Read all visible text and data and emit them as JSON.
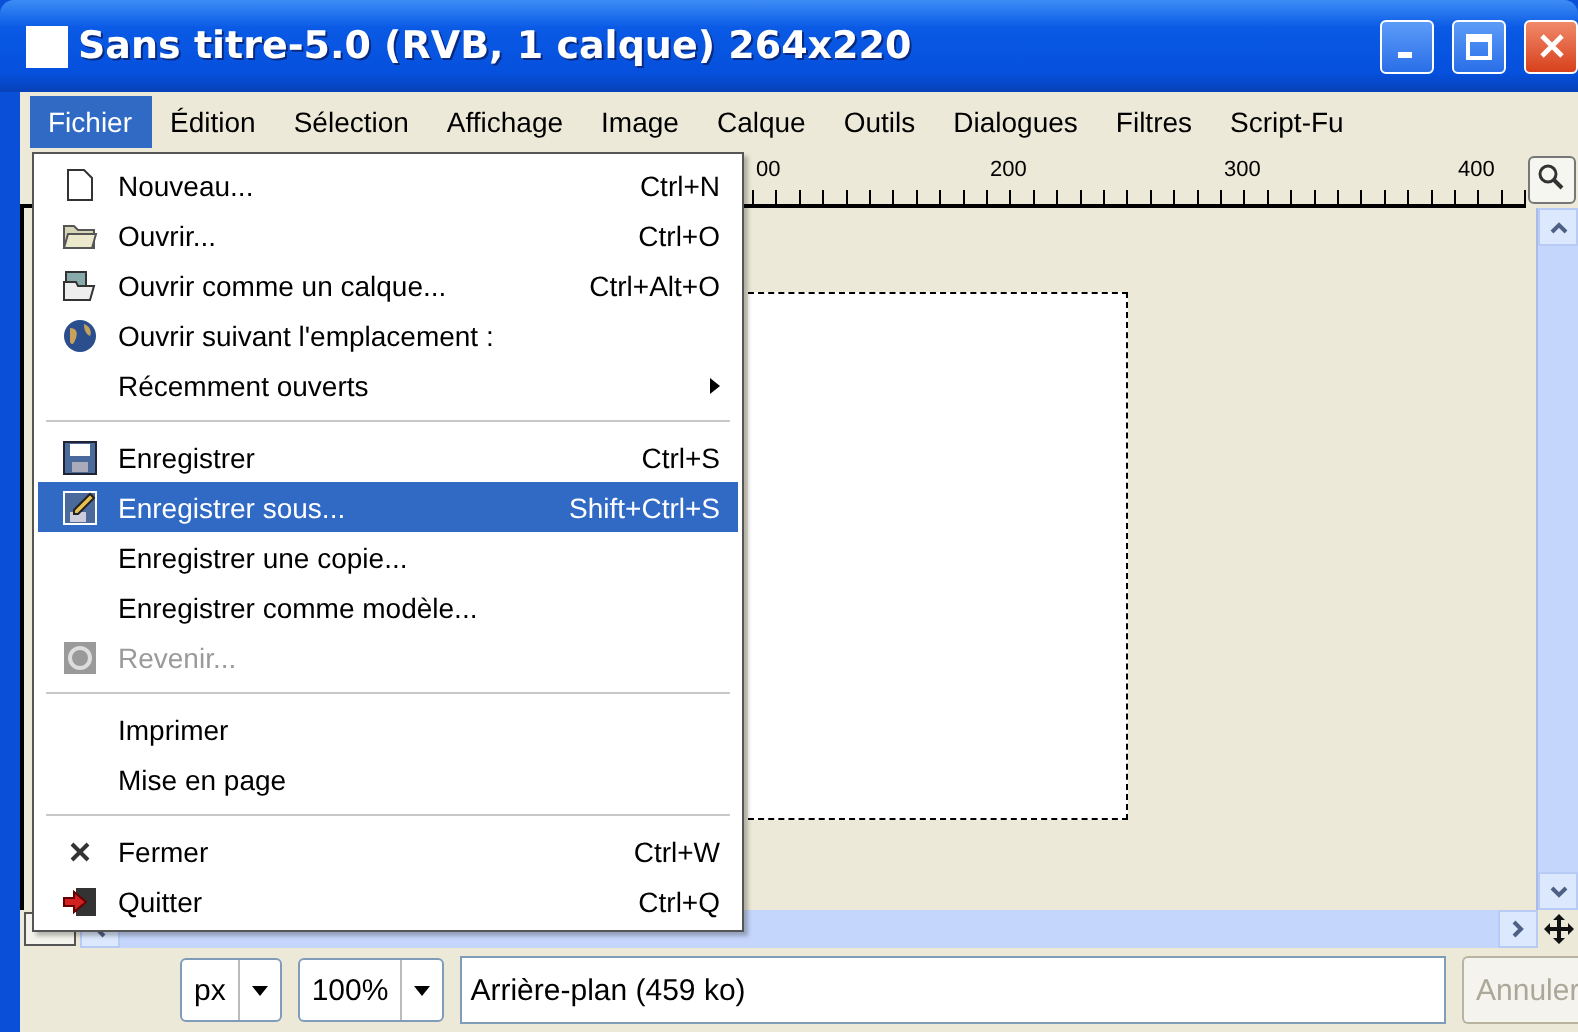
{
  "window": {
    "title": "Sans titre-5.0 (RVB, 1 calque) 264x220"
  },
  "menubar": [
    {
      "label": "Fichier",
      "selected": true
    },
    {
      "label": "Édition",
      "selected": false
    },
    {
      "label": "Sélection",
      "selected": false
    },
    {
      "label": "Affichage",
      "selected": false
    },
    {
      "label": "Image",
      "selected": false
    },
    {
      "label": "Calque",
      "selected": false
    },
    {
      "label": "Outils",
      "selected": false
    },
    {
      "label": "Dialogues",
      "selected": false
    },
    {
      "label": "Filtres",
      "selected": false
    },
    {
      "label": "Script-Fu",
      "selected": false
    }
  ],
  "file_menu": {
    "items": [
      {
        "kind": "item",
        "label": "Nouveau...",
        "shortcut": "Ctrl+N",
        "selected": false,
        "disabled": false
      },
      {
        "kind": "item",
        "label": "Ouvrir...",
        "shortcut": "Ctrl+O",
        "selected": false,
        "disabled": false
      },
      {
        "kind": "item",
        "label": "Ouvrir comme un calque...",
        "shortcut": "Ctrl+Alt+O",
        "selected": false,
        "disabled": false
      },
      {
        "kind": "item",
        "label": "Ouvrir suivant l'emplacement :",
        "selected": false,
        "disabled": false
      },
      {
        "kind": "submenu",
        "label": "Récemment ouverts",
        "selected": false,
        "disabled": false
      },
      {
        "kind": "separator"
      },
      {
        "kind": "item",
        "label": "Enregistrer",
        "shortcut": "Ctrl+S",
        "selected": false,
        "disabled": false
      },
      {
        "kind": "item",
        "label": "Enregistrer sous...",
        "shortcut": "Shift+Ctrl+S",
        "selected": true,
        "disabled": false
      },
      {
        "kind": "item",
        "label": "Enregistrer une copie...",
        "selected": false,
        "disabled": false
      },
      {
        "kind": "item",
        "label": "Enregistrer comme modèle...",
        "selected": false,
        "disabled": false
      },
      {
        "kind": "item",
        "label": "Revenir...",
        "selected": false,
        "disabled": true
      },
      {
        "kind": "separator"
      },
      {
        "kind": "item",
        "label": "Imprimer",
        "selected": false,
        "disabled": false
      },
      {
        "kind": "item",
        "label": "Mise en page",
        "selected": false,
        "disabled": false
      },
      {
        "kind": "separator"
      },
      {
        "kind": "item",
        "label": "Fermer",
        "shortcut": "Ctrl+W",
        "selected": false,
        "disabled": false
      },
      {
        "kind": "item",
        "label": "Quitter",
        "shortcut": "Ctrl+Q",
        "selected": false,
        "disabled": false
      }
    ]
  },
  "ruler": {
    "labels": [
      "00",
      "200",
      "300",
      "400"
    ]
  },
  "status_bar": {
    "unit": "px",
    "zoom": "100%",
    "layer_info": "Arrière-plan (459 ko)",
    "cancel_button": {
      "label": "Annuler",
      "disabled": true
    }
  }
}
